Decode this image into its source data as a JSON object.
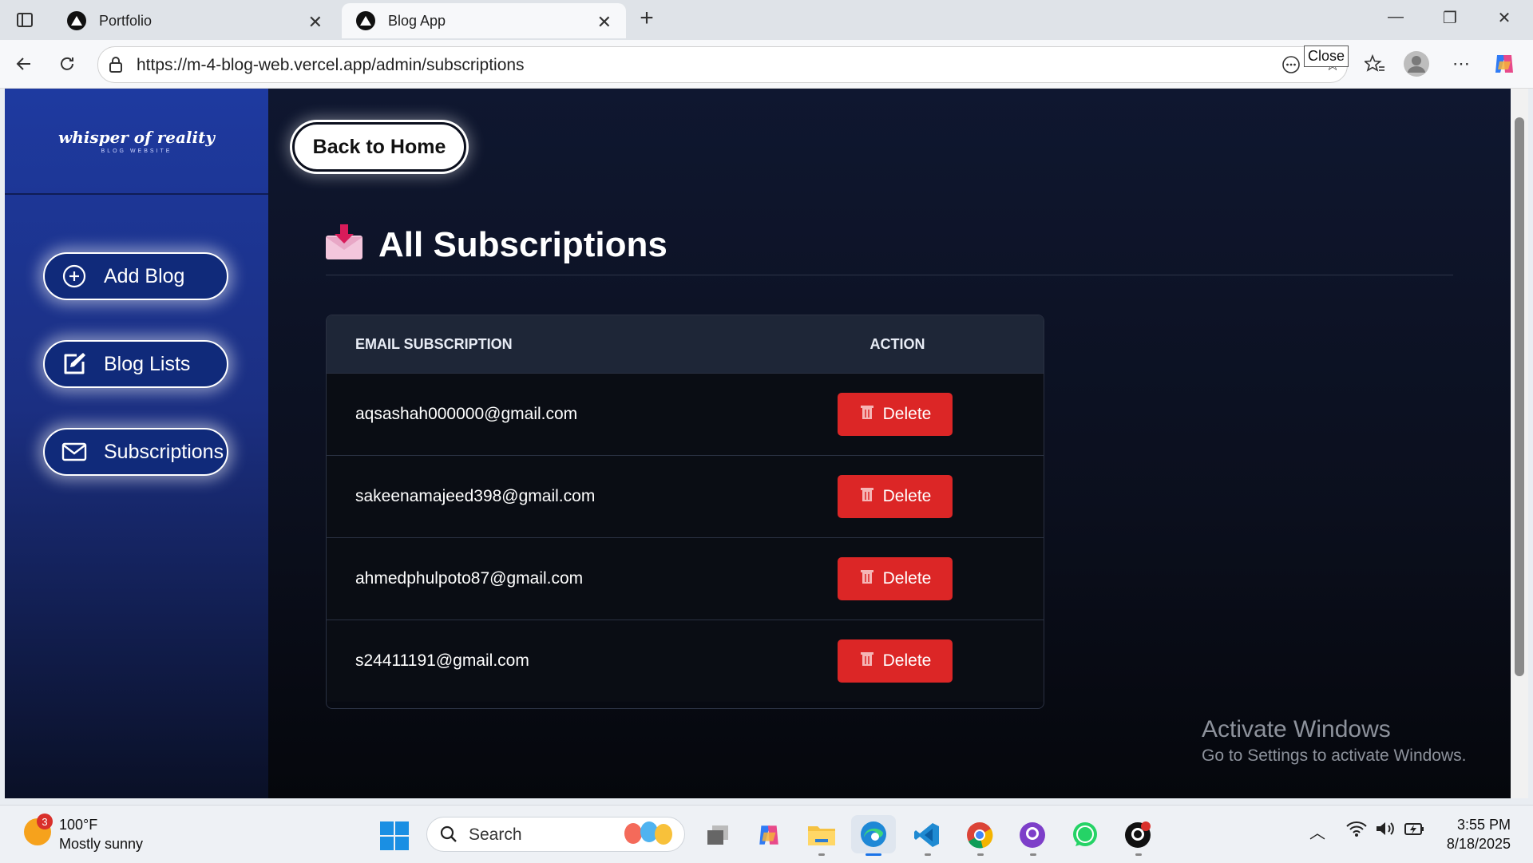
{
  "browser": {
    "tabs": [
      {
        "title": "Portfolio",
        "active": false
      },
      {
        "title": "Blog App",
        "active": true
      }
    ],
    "url": "https://m-4-blog-web.vercel.app/admin/subscriptions",
    "tooltip": "Close"
  },
  "sidebar": {
    "logo_title": "whisper of reality",
    "logo_subtitle": "BLOG WEBSITE",
    "items": [
      {
        "label": "Add Blog",
        "icon": "add-circle-icon"
      },
      {
        "label": "Blog Lists",
        "icon": "edit-icon"
      },
      {
        "label": "Subscriptions",
        "icon": "mail-icon"
      }
    ]
  },
  "main": {
    "back_label": "Back to Home",
    "title": "All Subscriptions",
    "table": {
      "headers": [
        "EMAIL SUBSCRIPTION",
        "ACTION"
      ],
      "rows": [
        {
          "email": "aqsashah000000@gmail.com",
          "action": "Delete"
        },
        {
          "email": "sakeenamajeed398@gmail.com",
          "action": "Delete"
        },
        {
          "email": "ahmedphulpoto87@gmail.com",
          "action": "Delete"
        },
        {
          "email": "s24411191@gmail.com",
          "action": "Delete"
        }
      ]
    }
  },
  "watermark": {
    "title": "Activate Windows",
    "subtitle": "Go to Settings to activate Windows."
  },
  "taskbar": {
    "weather_badge": "3",
    "temperature": "100°F",
    "condition": "Mostly sunny",
    "search_placeholder": "Search",
    "time": "3:55 PM",
    "date": "8/18/2025"
  },
  "colors": {
    "sidebar_top": "#1e3aa0",
    "sidebar_bottom": "#0a1026",
    "main_bg": "#0b0f1a",
    "delete_red": "#dc2626",
    "table_header": "#1e2637"
  }
}
